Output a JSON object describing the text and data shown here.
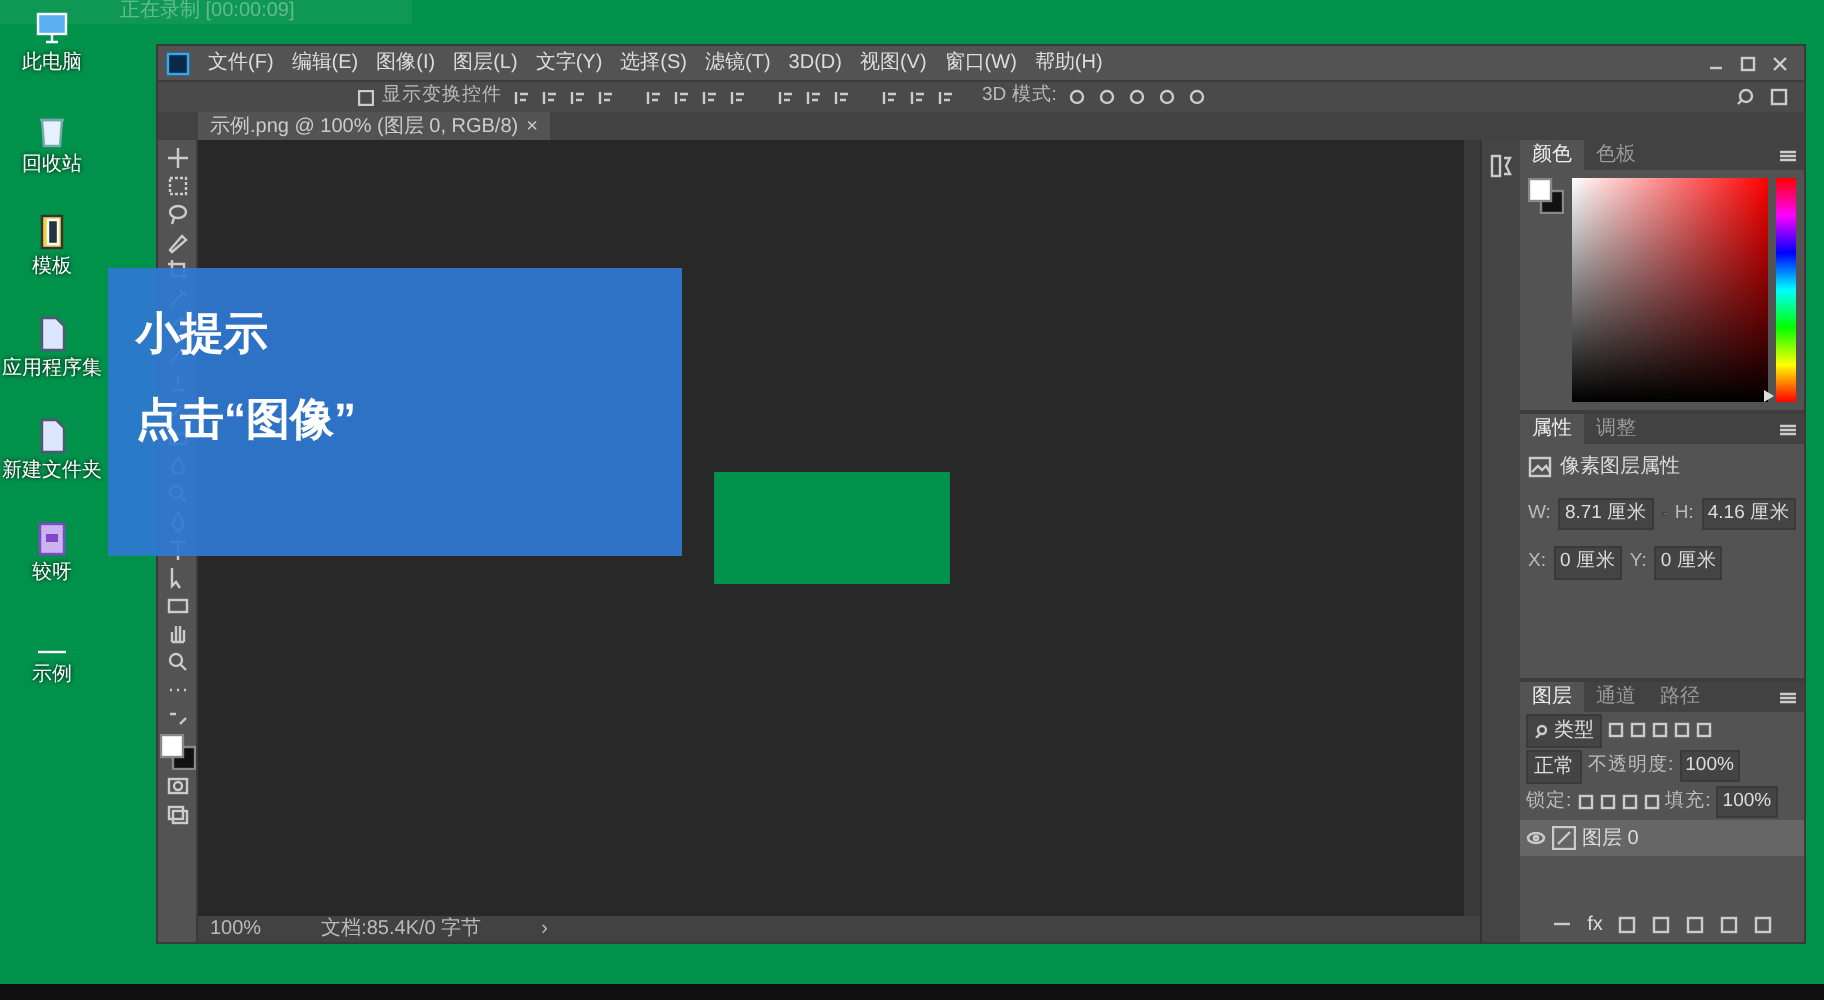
{
  "recording_bar": {
    "status": "正在录制 [00:00:09]"
  },
  "desktop_icons": [
    {
      "kind": "computer",
      "label": "此电脑"
    },
    {
      "kind": "recycle",
      "label": "回收站"
    },
    {
      "kind": "book",
      "label": "模板"
    },
    {
      "kind": "document",
      "label": "应用程序集"
    },
    {
      "kind": "document",
      "label": "新建文件夹"
    },
    {
      "kind": "media",
      "label": "较呀"
    },
    {
      "kind": "blank",
      "label": "示例"
    }
  ],
  "menu": [
    "文件(F)",
    "编辑(E)",
    "图像(I)",
    "图层(L)",
    "文字(Y)",
    "选择(S)",
    "滤镜(T)",
    "3D(D)",
    "视图(V)",
    "窗口(W)",
    "帮助(H)"
  ],
  "options_bar": {
    "show_transform_controls": {
      "label": "显示变换控件",
      "checked": false
    },
    "mode_label": "3D 模式:"
  },
  "document_tab": {
    "title": "示例.png @ 100% (图层 0, RGB/8)",
    "close": "×"
  },
  "color_panel": {
    "tabs": [
      {
        "label": "颜色",
        "selected": true
      },
      {
        "label": "色板",
        "selected": false
      }
    ],
    "hue_slider": {
      "level": 0
    }
  },
  "properties_panel": {
    "tabs": [
      {
        "label": "属性",
        "selected": true
      },
      {
        "label": "调整",
        "selected": false
      }
    ],
    "heading": "像素图层属性",
    "fields": [
      {
        "label": "W:",
        "value": "8.71 厘米"
      },
      {
        "label": "H:",
        "value": "4.16 厘米"
      },
      {
        "label": "X:",
        "value": "0 厘米"
      },
      {
        "label": "Y:",
        "value": "0 厘米"
      }
    ]
  },
  "layers_panel": {
    "tabs": [
      {
        "label": "图层",
        "selected": true
      },
      {
        "label": "通道",
        "selected": false
      },
      {
        "label": "路径",
        "selected": false
      }
    ],
    "filter": "类型",
    "blend_mode": "正常",
    "opacity_label": "不透明度:",
    "opacity": "100%",
    "lock_label": "锁定:",
    "fill_label": "填充:",
    "fill": "100%",
    "layers": [
      {
        "name": "图层 0",
        "visible": true,
        "selected": true
      }
    ],
    "footer_fx": "fx"
  },
  "status_bar": {
    "zoom": "100%",
    "doc_info": "文档:85.4K/0 字节",
    "arrow": "›"
  },
  "tip_overlay": {
    "title": "小提示",
    "text": "点击“图像”"
  }
}
